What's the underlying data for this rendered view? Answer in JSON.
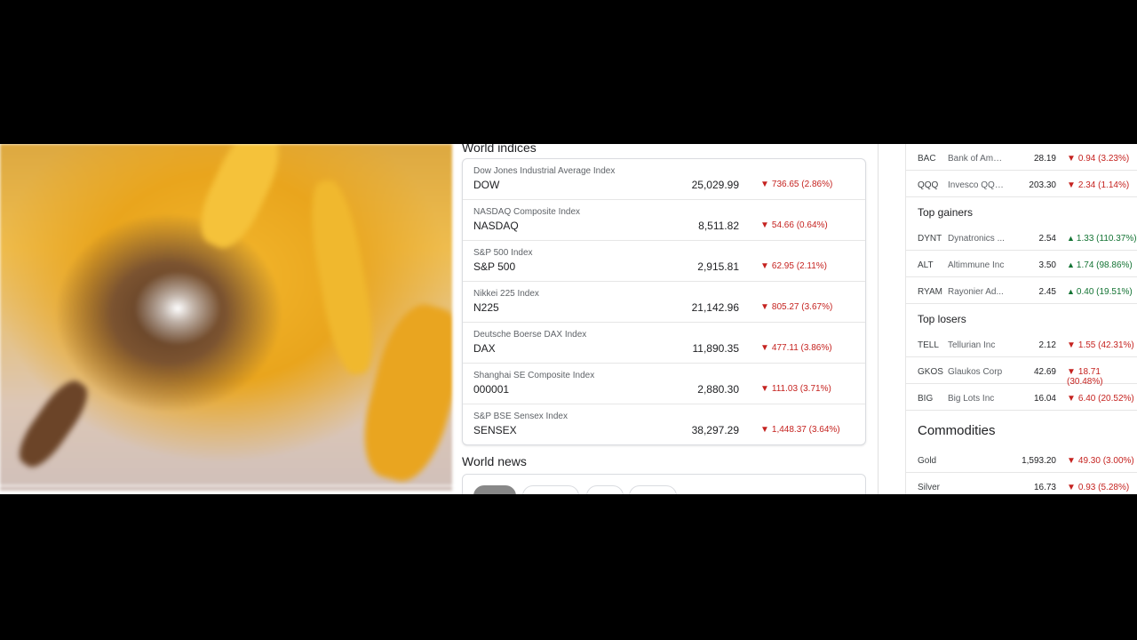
{
  "world_indices": {
    "title": "World indices",
    "rows": [
      {
        "name": "Dow Jones Industrial Average Index",
        "symbol": "DOW",
        "price": "25,029.99",
        "change": "736.65 (2.86%)"
      },
      {
        "name": "NASDAQ Composite Index",
        "symbol": "NASDAQ",
        "price": "8,511.82",
        "change": "54.66 (0.64%)"
      },
      {
        "name": "S&P 500 Index",
        "symbol": "S&P 500",
        "price": "2,915.81",
        "change": "62.95 (2.11%)"
      },
      {
        "name": "Nikkei 225 Index",
        "symbol": "N225",
        "price": "21,142.96",
        "change": "805.27 (3.67%)"
      },
      {
        "name": "Deutsche Boerse DAX Index",
        "symbol": "DAX",
        "price": "11,890.35",
        "change": "477.11 (3.86%)"
      },
      {
        "name": "Shanghai SE Composite Index",
        "symbol": "000001",
        "price": "2,880.30",
        "change": "111.03 (3.71%)"
      },
      {
        "name": "S&P BSE Sensex Index",
        "symbol": "SENSEX",
        "price": "38,297.29",
        "change": "1,448.37 (3.64%)"
      }
    ]
  },
  "world_news": {
    "title": "World news"
  },
  "video": {
    "progress": 0.0
  },
  "most_active": [
    {
      "symbol": "BAC",
      "name": "Bank of Amer...",
      "price": "28.19",
      "change": "0.94 (3.23%)",
      "direction": "down"
    },
    {
      "symbol": "QQQ",
      "name": "Invesco QQQ ...",
      "price": "203.30",
      "change": "2.34 (1.14%)",
      "direction": "down"
    }
  ],
  "top_gainers": {
    "title": "Top gainers",
    "rows": [
      {
        "symbol": "DYNT",
        "name": "Dynatronics ...",
        "price": "2.54",
        "change": "1.33 (110.37%)",
        "direction": "up"
      },
      {
        "symbol": "ALT",
        "name": "Altimmune Inc",
        "price": "3.50",
        "change": "1.74 (98.86%)",
        "direction": "up"
      },
      {
        "symbol": "RYAM",
        "name": "Rayonier Ad...",
        "price": "2.45",
        "change": "0.40 (19.51%)",
        "direction": "up"
      }
    ]
  },
  "top_losers": {
    "title": "Top losers",
    "rows": [
      {
        "symbol": "TELL",
        "name": "Tellurian Inc",
        "price": "2.12",
        "change": "1.55 (42.31%)",
        "direction": "down"
      },
      {
        "symbol": "GKOS",
        "name": "Glaukos Corp",
        "price": "42.69",
        "change": "18.71 (30.48%)",
        "direction": "down"
      },
      {
        "symbol": "BIG",
        "name": "Big Lots Inc",
        "price": "16.04",
        "change": "6.40 (20.52%)",
        "direction": "down"
      }
    ]
  },
  "commodities": {
    "title": "Commodities",
    "rows": [
      {
        "name": "Gold",
        "price": "1,593.20",
        "change": "49.30 (3.00%)",
        "direction": "down"
      },
      {
        "name": "Silver",
        "price": "16.73",
        "change": "0.93 (5.28%)",
        "direction": "down"
      }
    ]
  },
  "colors": {
    "negative": "#c5221f",
    "positive": "#137333"
  },
  "icons": {
    "down": "down-triangle-icon",
    "up": "up-triangle-icon"
  }
}
